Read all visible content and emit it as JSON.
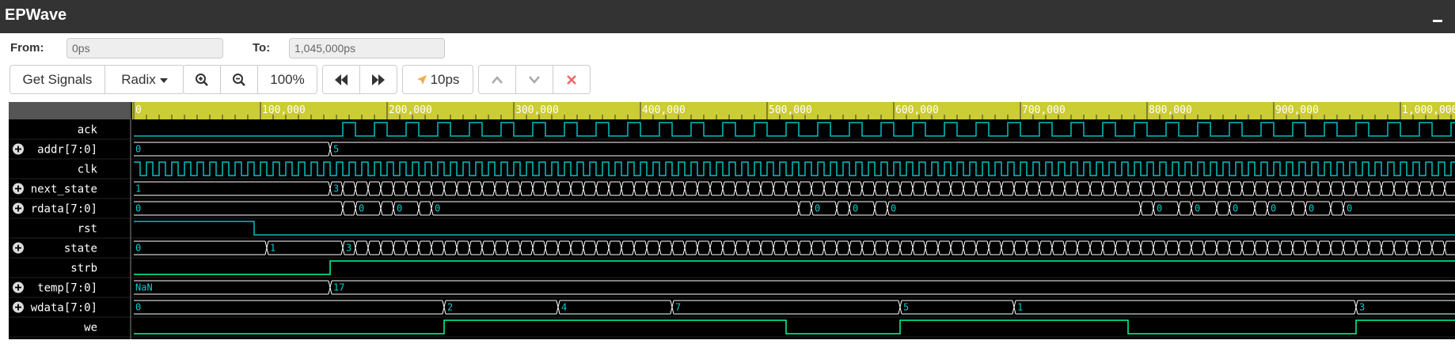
{
  "app": {
    "title": "EPWave"
  },
  "range": {
    "from_label": "From:",
    "from_value": "0ps",
    "to_label": "To:",
    "to_value": "1,045,000ps"
  },
  "toolbar": {
    "get_signals_label": "Get Signals",
    "radix_label": "Radix",
    "zoom_level": "100%",
    "cursor_step_label": "10ps"
  },
  "colors": {
    "ruler_bg": "#cccc33",
    "wave_bg": "#000000",
    "wave_line": "#00c0c0",
    "wave_line_bright": "#00ff99",
    "grid": "#ffffff"
  },
  "ruler": {
    "ticks": [
      "0",
      "100,000",
      "200,000",
      "300,000",
      "400,000",
      "500,000",
      "600,000",
      "700,000",
      "800,000",
      "900,000",
      "1,000,000"
    ]
  },
  "signals": [
    {
      "name": "ack",
      "expandable": false,
      "kind": "bit"
    },
    {
      "name": "addr[7:0]",
      "expandable": true,
      "kind": "bus",
      "values": [
        "0",
        "5"
      ]
    },
    {
      "name": "clk",
      "expandable": false,
      "kind": "clock"
    },
    {
      "name": "next_state",
      "expandable": true,
      "kind": "bus",
      "values": [
        "1",
        "3"
      ]
    },
    {
      "name": "rdata[7:0]",
      "expandable": true,
      "kind": "bus",
      "values": [
        "0"
      ]
    },
    {
      "name": "rst",
      "expandable": false,
      "kind": "bit"
    },
    {
      "name": "state",
      "expandable": true,
      "kind": "bus",
      "values": [
        "0",
        "1",
        "3"
      ]
    },
    {
      "name": "strb",
      "expandable": false,
      "kind": "bit"
    },
    {
      "name": "temp[7:0]",
      "expandable": true,
      "kind": "bus",
      "values": [
        "NaN",
        "17"
      ]
    },
    {
      "name": "wdata[7:0]",
      "expandable": true,
      "kind": "bus",
      "values": [
        "0",
        "2",
        "4",
        "7",
        "5",
        "1",
        "3"
      ]
    },
    {
      "name": "we",
      "expandable": false,
      "kind": "bit"
    }
  ]
}
